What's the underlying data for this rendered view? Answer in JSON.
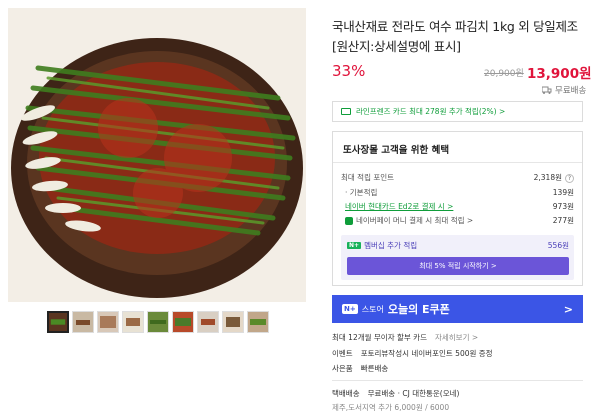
{
  "product": {
    "title": "국내산재료 전라도 여수 파김치 1kg 외 당일제조 [원산지:상세설명에 표시]",
    "discount": "33%",
    "original_price": "20,900원",
    "sale_price": "13,900원",
    "shipping_chip": "무료배송"
  },
  "card_banner": {
    "text": "라인프렌즈 카드 최대 278원 추가 적립(2%) >"
  },
  "benefits": {
    "title": "또사장몰 고객을 위한 혜택",
    "max_points_label": "최대 적립 포인트",
    "max_points_value": "2,318원",
    "basic_label": "· 기본적립",
    "basic_value": "139원",
    "naver_card_label": "네이버 현대카드 Ed2로 결제 시 >",
    "naver_card_value": "973원",
    "naver_money_label": "네이버페이 머니 결제 시 최대 적립 >",
    "naver_money_value": "277원",
    "membership_badge": "N+",
    "membership_label": "멤버십 추가 적립",
    "membership_value": "556원",
    "membership_button": "최대 5% 적립 시작하기 >"
  },
  "coupon_banner": {
    "logo": "N+",
    "prefix": "스토어",
    "main": "오늘의 E쿠폰",
    "arrow": ">"
  },
  "meta": {
    "installment_label": "최대 12개월 무이자 할부 카드",
    "installment_link": "자세히보기 >",
    "event_label": "이벤트",
    "event_text": "포토리뷰작성시 네이버포인트 500원 증정",
    "gift_label": "사은품",
    "gift_text": "빠른배송",
    "delivery_label": "택배배송",
    "delivery_text": "무료배송 · CJ 대한통운(오네)",
    "jeju_text": "제주,도서지역 추가 6,000원 / 6000"
  },
  "icons": {
    "truck": "truck-icon",
    "card": "card-icon",
    "help": "question-mark-icon"
  },
  "colors": {
    "accent_red": "#e0143b",
    "naver_green": "#0f9d3a",
    "membership_purple": "#6b55d8",
    "coupon_blue": "#3b55e6"
  }
}
